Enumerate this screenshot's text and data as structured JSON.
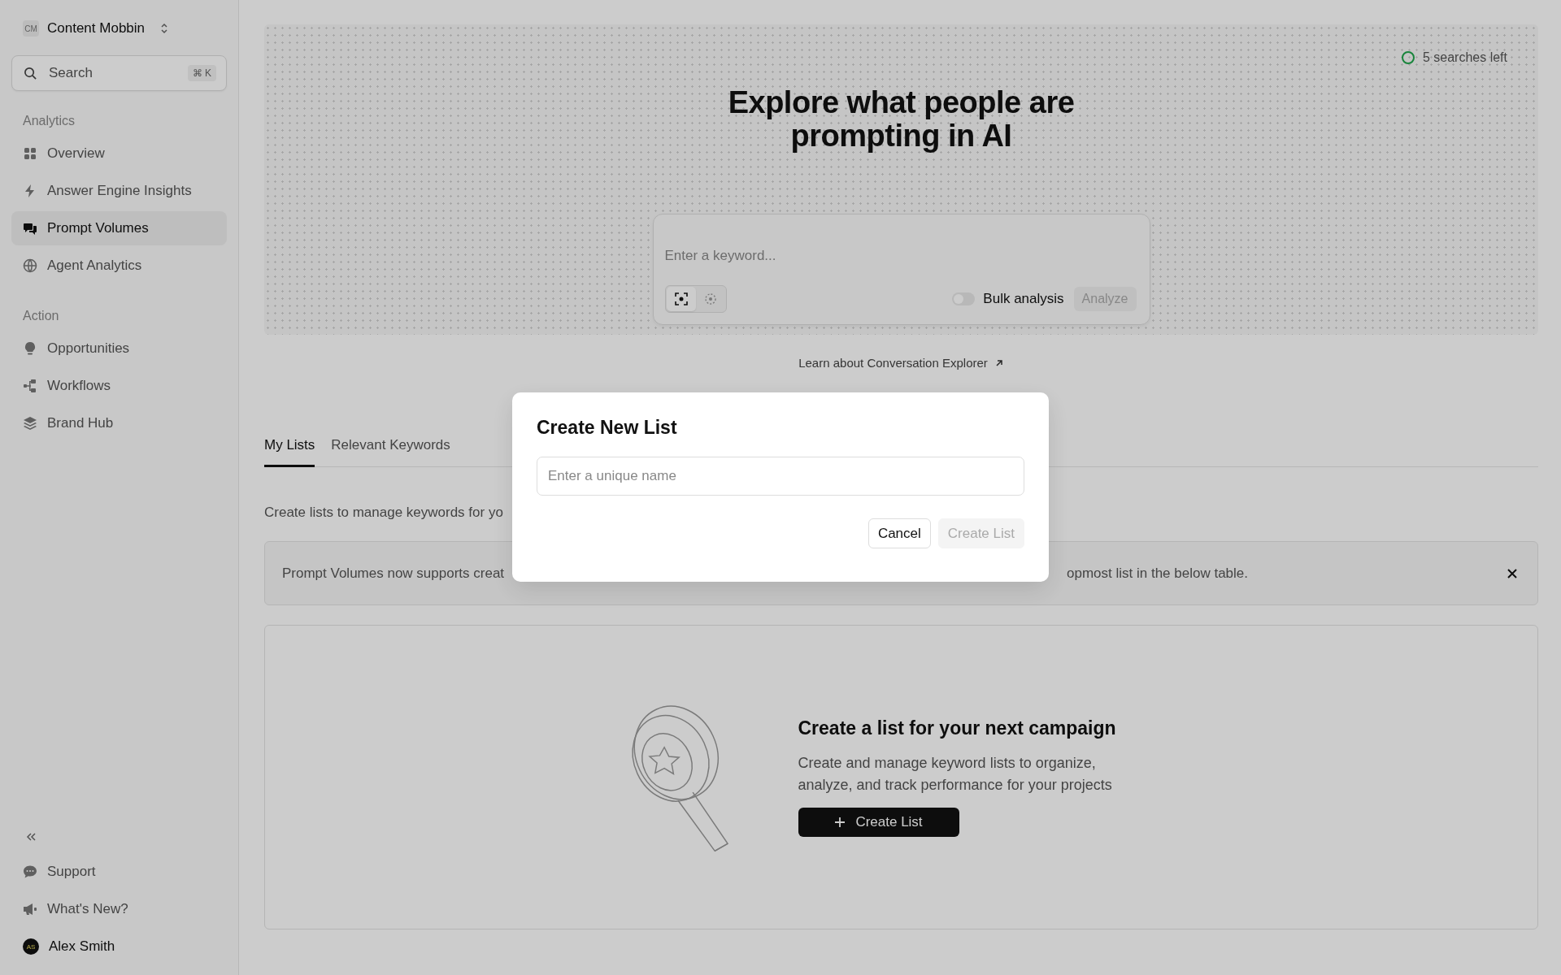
{
  "sidebar": {
    "workspace": {
      "badge": "CM",
      "name": "Content Mobbin"
    },
    "search": {
      "placeholder": "Search",
      "shortcut": "⌘ K"
    },
    "sections": [
      {
        "title": "Analytics",
        "items": [
          {
            "label": "Overview",
            "selected": false
          },
          {
            "label": "Answer Engine Insights",
            "selected": false
          },
          {
            "label": "Prompt Volumes",
            "selected": true
          },
          {
            "label": "Agent Analytics",
            "selected": false
          }
        ]
      },
      {
        "title": "Action",
        "items": [
          {
            "label": "Opportunities",
            "selected": false
          },
          {
            "label": "Workflows",
            "selected": false
          },
          {
            "label": "Brand Hub",
            "selected": false
          }
        ]
      }
    ],
    "footer_items": [
      {
        "label": "Support"
      },
      {
        "label": "What's New?"
      }
    ],
    "user": {
      "initials": "AS",
      "name": "Alex Smith"
    }
  },
  "hero": {
    "quota": "5 searches left",
    "heading": "Explore what people are prompting in AI",
    "keyword_field": {
      "placeholder": "Enter a keyword..."
    },
    "modes": [
      {
        "selected": true
      },
      {
        "selected": false
      }
    ],
    "bulk_analysis": {
      "label": "Bulk analysis",
      "on": false
    },
    "analyze_button": {
      "label": "Analyze",
      "disabled": true
    },
    "learn_link": "Learn about Conversation Explorer"
  },
  "tabs": [
    {
      "label": "My Lists",
      "selected": true
    },
    {
      "label": "Relevant Keywords",
      "selected": false
    }
  ],
  "description": "Create lists to manage keywords for yo",
  "banner": {
    "text_left": "Prompt Volumes now supports creat",
    "text_right": "opmost list in the below table."
  },
  "empty_state": {
    "title": "Create a list for your next campaign",
    "text": "Create and manage keyword lists to organize, analyze, and track performance for your projects",
    "button": "Create List"
  },
  "modal": {
    "title": "Create New List",
    "name_field": {
      "placeholder": "Enter a unique name"
    },
    "cancel": "Cancel",
    "create": {
      "label": "Create List",
      "disabled": true
    }
  }
}
